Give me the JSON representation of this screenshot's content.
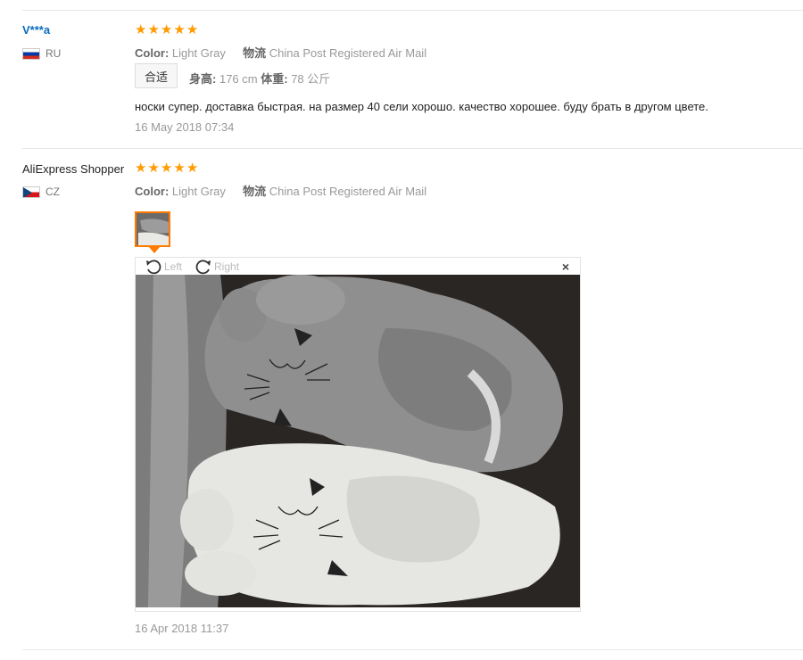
{
  "reviews": [
    {
      "user": "V***a",
      "country": "RU",
      "rating": 5,
      "color_label": "Color:",
      "color_value": "Light Gray",
      "shipping_label": "物流",
      "shipping_value": "China Post Registered Air Mail",
      "fit": "合适",
      "height_label": "身高:",
      "height_value": "176 cm",
      "weight_label": "体重:",
      "weight_value": "78 公斤",
      "text": "носки супер. доставка быстрая. на размер 40 сели хорошо. качество хорошее. буду брать в другом цвете.",
      "date": "16 May 2018 07:34"
    },
    {
      "user": "AliExpress Shopper",
      "country": "CZ",
      "rating": 5,
      "color_label": "Color:",
      "color_value": "Light Gray",
      "shipping_label": "物流",
      "shipping_value": "China Post Registered Air Mail",
      "date": "16 Apr 2018 11:37"
    }
  ],
  "viewer": {
    "rotate_left": "Left",
    "rotate_right": "Right",
    "close": "×"
  },
  "icons": {
    "star": "star-icon",
    "rotate_left": "rotate-left-icon",
    "rotate_right": "rotate-right-icon",
    "close": "close-icon"
  },
  "colors": {
    "star": "#ff9a00",
    "link": "#0c6bbd",
    "thumb_border": "#ff7a00"
  }
}
